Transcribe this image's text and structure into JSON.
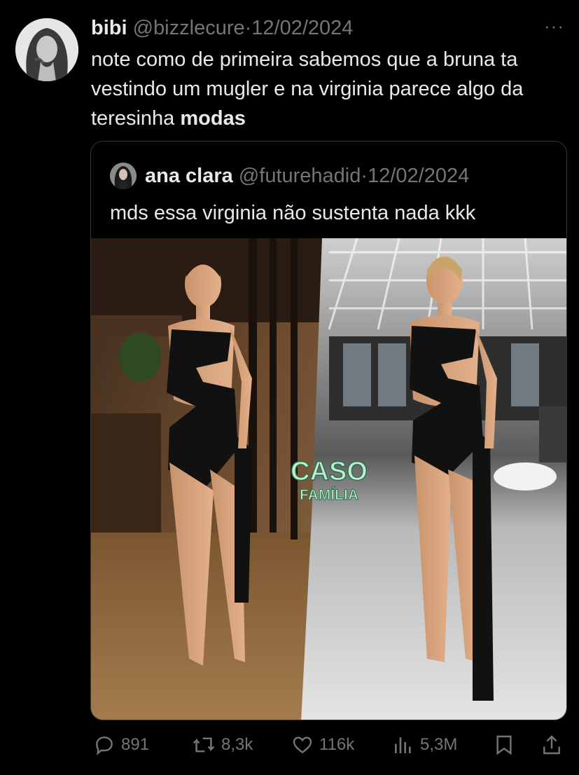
{
  "tweet": {
    "author_name": "bibi",
    "author_handle": "@bizzlecure",
    "separator": "·",
    "date": "12/02/2024",
    "more_label": "···",
    "text_plain": "note como de primeira sabemos que a bruna ta vestindo um mugler e na virginia parece algo da teresinha ",
    "text_bold": "modas"
  },
  "quote": {
    "author_name": "ana clara",
    "author_handle": "@futurehadid",
    "separator": "·",
    "date": "12/02/2024",
    "text": "mds essa virginia não sustenta nada kkk",
    "watermark_line1": "CASO",
    "watermark_line2": "FAMÍLIA"
  },
  "actions": {
    "replies": "891",
    "reposts": "8,3k",
    "likes": "116k",
    "views": "5,3M"
  },
  "icons": [
    "reply-icon",
    "repost-icon",
    "like-icon",
    "views-icon",
    "bookmark-icon",
    "share-icon"
  ],
  "colors": {
    "background": "#000000",
    "text": "#e7e9ea",
    "muted": "#71767b",
    "border": "#333639",
    "watermark": "#b8f0d0"
  }
}
